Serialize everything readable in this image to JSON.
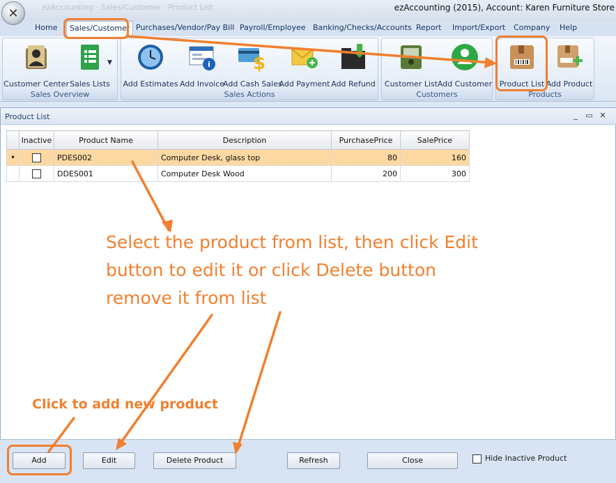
{
  "titlebar": {
    "app_title": "ezAccounting (2015), Account: Karen Furniture Store",
    "faded_text": "ezAccounting  ·  Sales/Customer  ·  Product List"
  },
  "menu": {
    "items": [
      "Home",
      "Sales/Customer",
      "Purchases/Vendor/Pay Bill",
      "Payroll/Employee",
      "Banking/Checks/Accounts",
      "Report",
      "Import/Export",
      "Company",
      "Help"
    ],
    "active_index": 1
  },
  "ribbon": {
    "groups": [
      {
        "label": "Sales Overview",
        "buttons": [
          "Customer Center",
          "Sales Lists"
        ]
      },
      {
        "label": "Sales Actions",
        "buttons": [
          "Add Estimates",
          "Add Invoice",
          "Add Cash Sales",
          "Add Payment",
          "Add Refund"
        ]
      },
      {
        "label": "Customers",
        "buttons": [
          "Customer List",
          "Add Customer"
        ]
      },
      {
        "label": "Products",
        "buttons": [
          "Product List",
          "Add Product"
        ]
      }
    ]
  },
  "window": {
    "title": "Product List",
    "controls": [
      "_",
      "▭",
      "✕"
    ]
  },
  "grid": {
    "columns": [
      "Inactive",
      "Product Name",
      "Description",
      "PurchasePrice",
      "SalePrice"
    ],
    "rows": [
      {
        "inactive": false,
        "name": "PDES002",
        "description": "Computer Desk, glass top",
        "purchase": "80",
        "sale": "160",
        "selected": true
      },
      {
        "inactive": false,
        "name": "DDES001",
        "description": "Computer Desk Wood",
        "purchase": "200",
        "sale": "300",
        "selected": false
      }
    ],
    "row_indicator": "➧"
  },
  "annotations": {
    "main": "Select the product from list, then click Edit button to edit it or click Delete button remove it from list",
    "add": "Click to add new product"
  },
  "buttons": {
    "add": "Add",
    "edit": "Edit",
    "delete": "Delete Product",
    "refresh": "Refresh",
    "close": "Close",
    "hide_inactive": "Hide Inactive Product"
  },
  "colors": {
    "annotation": "#f08030",
    "selected_row": "#fdd9a1"
  }
}
